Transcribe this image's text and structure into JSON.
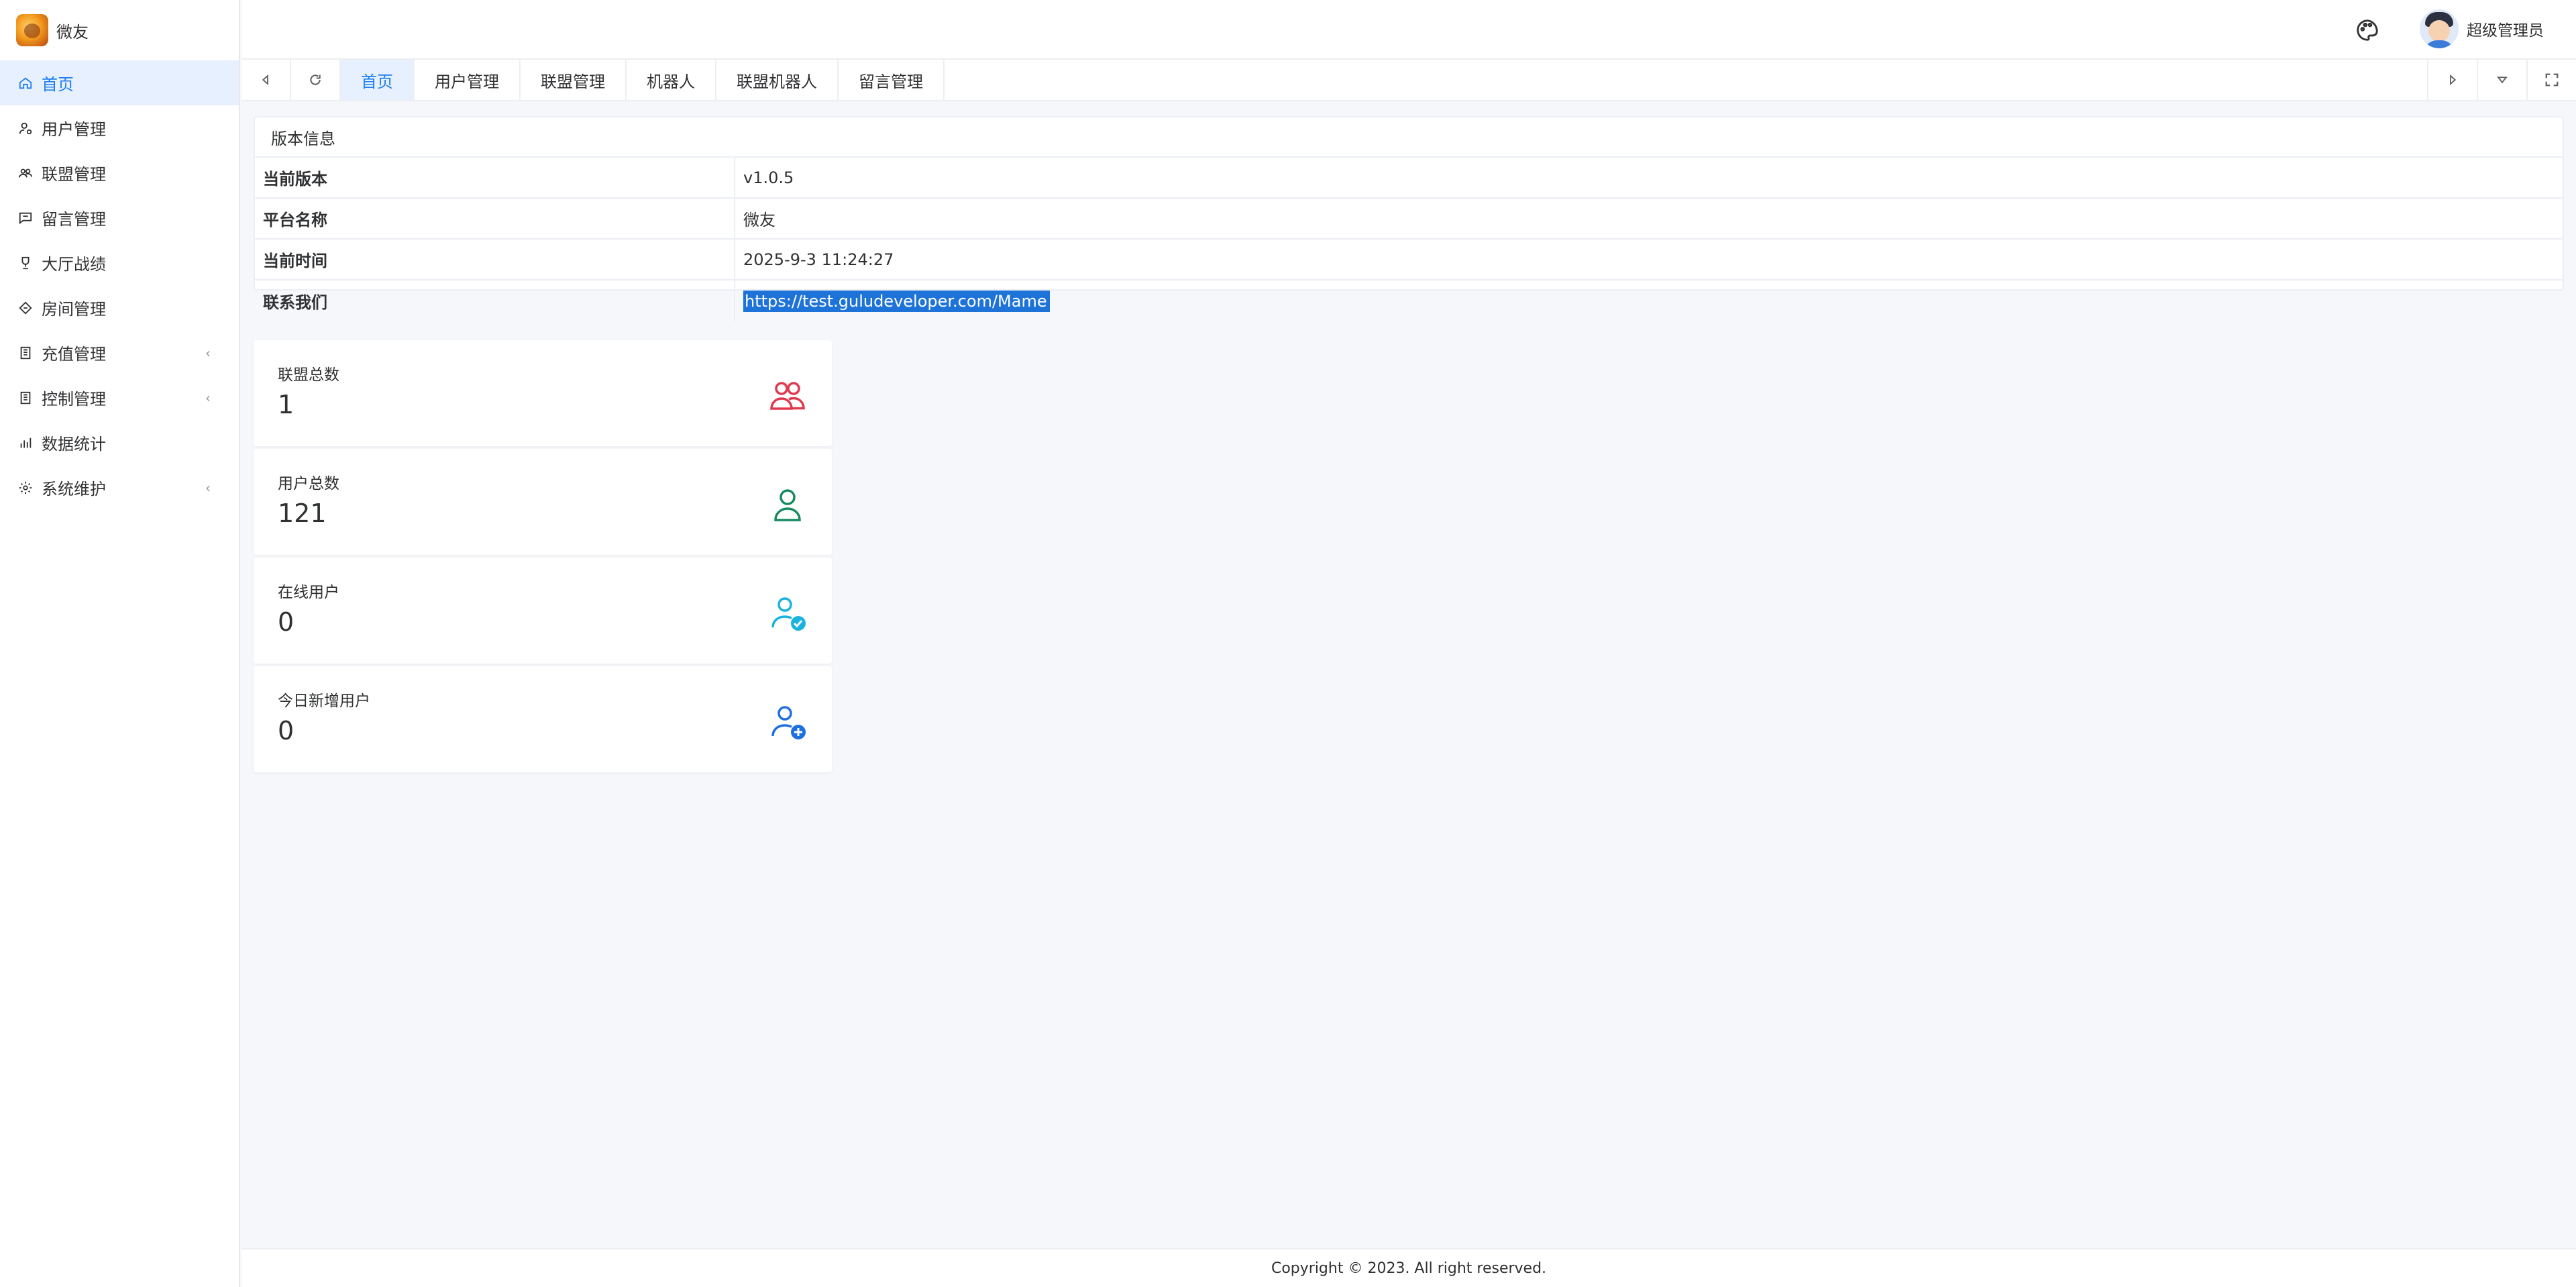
{
  "app": {
    "title": "微友"
  },
  "sidebar": {
    "items": [
      {
        "label": "首页",
        "icon": "home-icon",
        "active": true
      },
      {
        "label": "用户管理",
        "icon": "user-gear-icon"
      },
      {
        "label": "联盟管理",
        "icon": "users-icon"
      },
      {
        "label": "留言管理",
        "icon": "message-icon"
      },
      {
        "label": "大厅战绩",
        "icon": "trophy-icon"
      },
      {
        "label": "房间管理",
        "icon": "diamond-icon"
      },
      {
        "label": "充值管理",
        "icon": "building-icon",
        "expandable": true
      },
      {
        "label": "控制管理",
        "icon": "building-icon",
        "expandable": true
      },
      {
        "label": "数据统计",
        "icon": "bar-chart-icon"
      },
      {
        "label": "系统维护",
        "icon": "gear-icon",
        "expandable": true
      }
    ]
  },
  "header": {
    "user_name": "超级管理员"
  },
  "tabs": [
    {
      "label": "首页",
      "active": true
    },
    {
      "label": "用户管理"
    },
    {
      "label": "联盟管理"
    },
    {
      "label": "机器人"
    },
    {
      "label": "联盟机器人"
    },
    {
      "label": "留言管理"
    }
  ],
  "info": {
    "title": "版本信息",
    "rows": [
      {
        "label": "当前版本",
        "value": "v1.0.5"
      },
      {
        "label": "平台名称",
        "value": "微友"
      },
      {
        "label": "当前时间",
        "value": "2025-9-3 11:24:27"
      },
      {
        "label": "联系我们",
        "value": "https://test.guludeveloper.com/Mame"
      }
    ]
  },
  "stats": [
    {
      "title": "联盟总数",
      "value": "1",
      "icon": "group-icon",
      "color": "#e0394f"
    },
    {
      "title": "用户总数",
      "value": "121",
      "icon": "user-icon",
      "color": "#178a5e"
    },
    {
      "title": "在线用户",
      "value": "0",
      "icon": "user-check-icon",
      "color": "#1ab3e0"
    },
    {
      "title": "今日新增用户",
      "value": "0",
      "icon": "user-add-icon",
      "color": "#1f6fe0"
    }
  ],
  "footer": {
    "text": "Copyright © 2023. All right reserved."
  },
  "colors": {
    "accent": "#1e7ef0",
    "active_bg": "#e6f0fe",
    "selection": "#1e73d9"
  }
}
